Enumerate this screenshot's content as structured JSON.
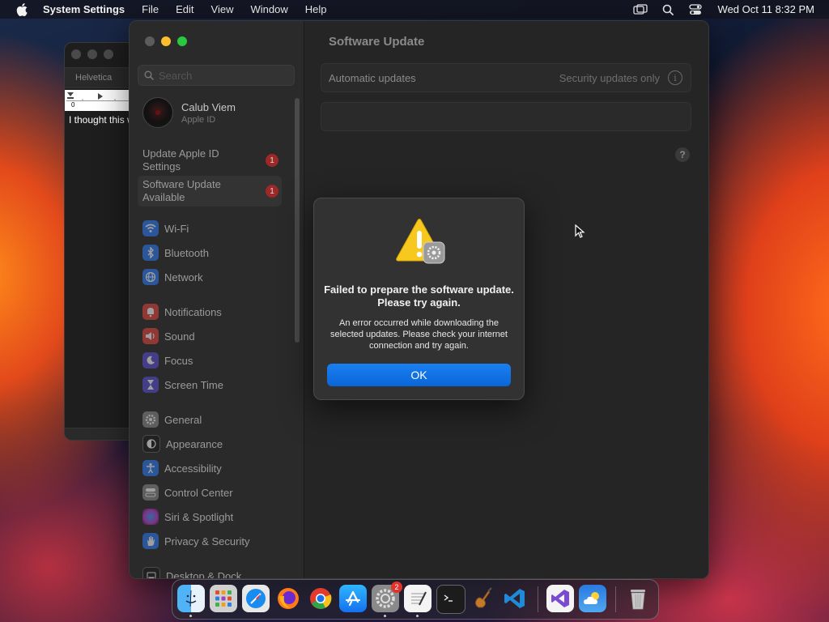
{
  "menubar": {
    "app_name": "System Settings",
    "menus": [
      "File",
      "Edit",
      "View",
      "Window",
      "Help"
    ],
    "clock": "Wed Oct 11  8:32 PM"
  },
  "textedit": {
    "font_name": "Helvetica",
    "ruler_zero": "0",
    "text": "I thought this w"
  },
  "sidebar": {
    "search_placeholder": "Search",
    "account": {
      "name": "Calub Viem",
      "subtitle": "Apple ID"
    },
    "notices": [
      {
        "label": "Update Apple ID Settings",
        "badge": "1"
      },
      {
        "label": "Software Update Available",
        "badge": "1"
      }
    ],
    "items": [
      {
        "label": "Wi-Fi",
        "icon": "wifi-icon",
        "color": "#2d7cf6"
      },
      {
        "label": "Bluetooth",
        "icon": "bluetooth-icon",
        "color": "#2d7cf6"
      },
      {
        "label": "Network",
        "icon": "globe-icon",
        "color": "#2d7cf6"
      },
      {
        "label": "Notifications",
        "icon": "bell-icon",
        "color": "#e5453b"
      },
      {
        "label": "Sound",
        "icon": "speaker-icon",
        "color": "#e5453b"
      },
      {
        "label": "Focus",
        "icon": "moon-icon",
        "color": "#5b4fd6"
      },
      {
        "label": "Screen Time",
        "icon": "hourglass-icon",
        "color": "#5b4fd6"
      },
      {
        "label": "General",
        "icon": "gear-icon",
        "color": "#8a8a8a"
      },
      {
        "label": "Appearance",
        "icon": "appearance-icon",
        "color": "#1c1c1c"
      },
      {
        "label": "Accessibility",
        "icon": "accessibility-icon",
        "color": "#2d7cf6"
      },
      {
        "label": "Control Center",
        "icon": "control-center-icon",
        "color": "#8a8a8a"
      },
      {
        "label": "Siri & Spotlight",
        "icon": "siri-icon",
        "color": "#c03ad0"
      },
      {
        "label": "Privacy & Security",
        "icon": "hand-icon",
        "color": "#2d7cf6"
      },
      {
        "label": "Desktop & Dock",
        "icon": "desktop-icon",
        "color": "#1c1c1c"
      }
    ]
  },
  "main": {
    "title": "Software Update",
    "auto_updates_label": "Automatic updates",
    "auto_updates_value": "Security updates only",
    "help": "?"
  },
  "alert": {
    "title": "Failed to prepare the software update. Please try again.",
    "message": "An error occurred while downloading the selected updates. Please check your internet connection and try again.",
    "ok": "OK"
  },
  "dock": {
    "apps": [
      "Finder",
      "Launchpad",
      "Safari",
      "Firefox",
      "Chrome",
      "App Store",
      "System Settings",
      "TextEdit",
      "Terminal",
      "Instruments",
      "Visual Studio Code",
      "Visual Studio",
      "Weather",
      "Trash"
    ],
    "settings_badge": "2"
  },
  "colors": {
    "accent": "#0a66d8",
    "badge": "#9c2828",
    "traffic_close": "#ff5f57",
    "traffic_min": "#febc2e",
    "traffic_max": "#28c840"
  }
}
